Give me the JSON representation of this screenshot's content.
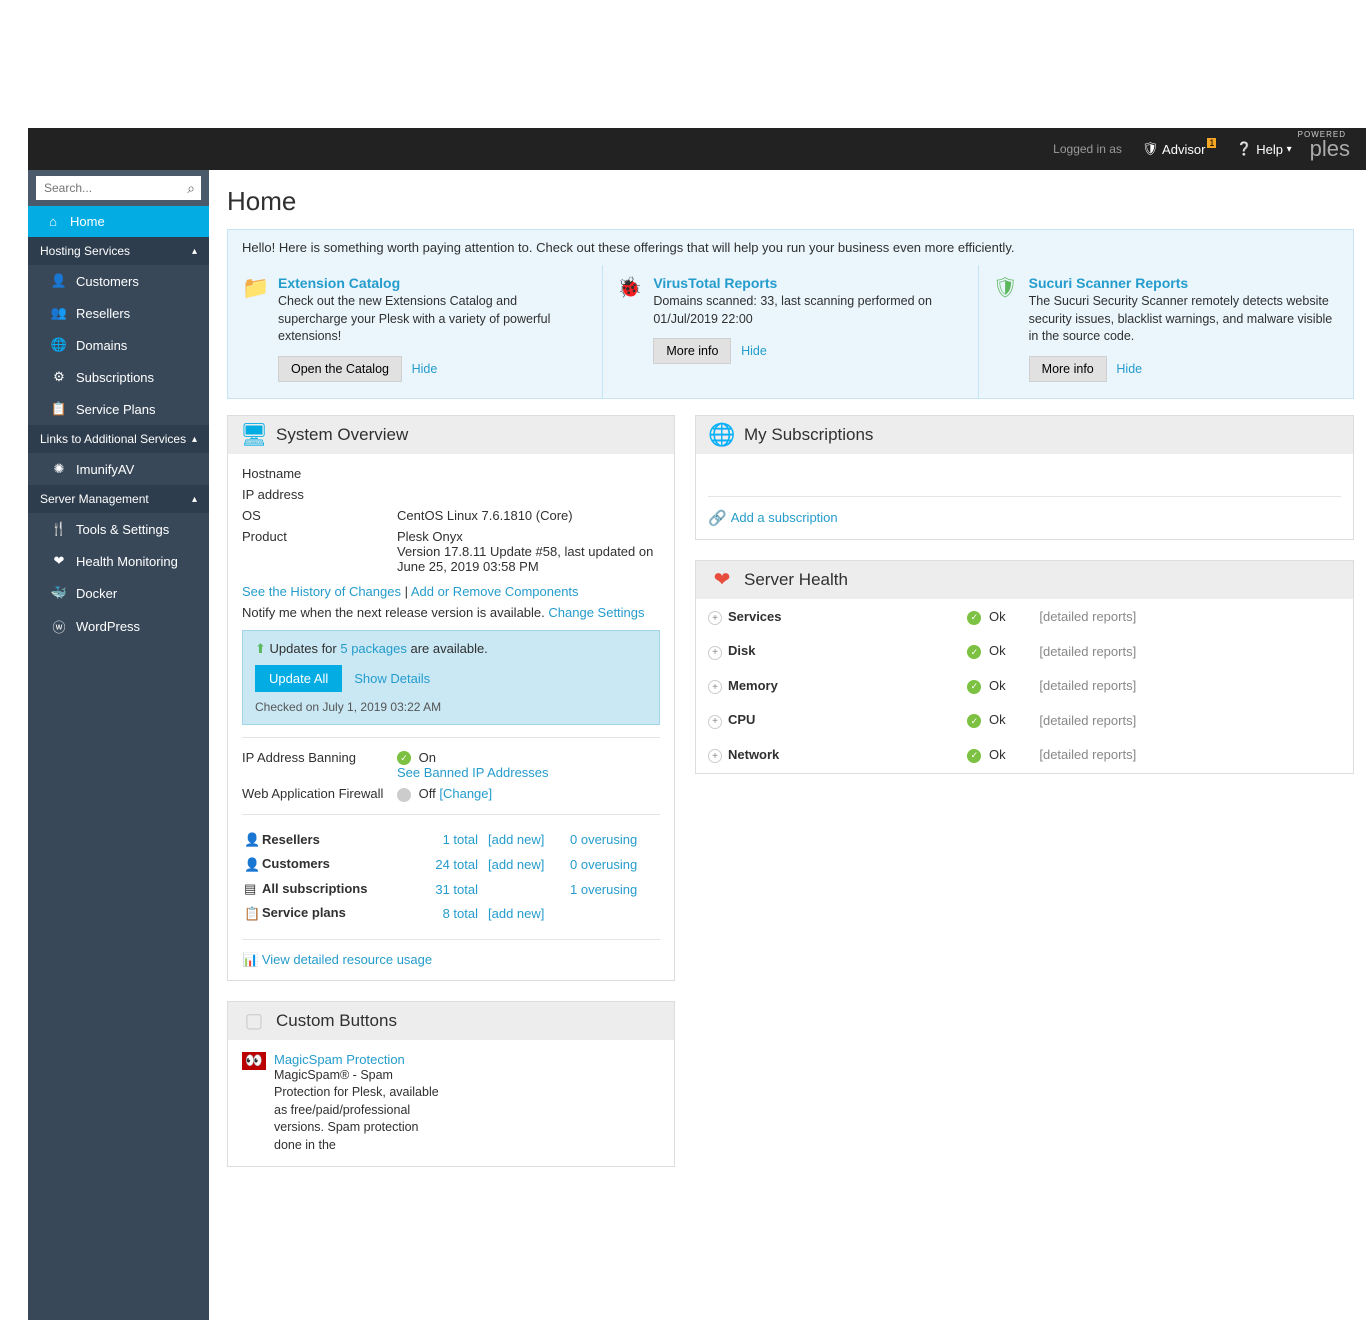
{
  "topbar": {
    "logged_in": "Logged in as",
    "advisor": "Advisor",
    "advisor_badge": "1",
    "help": "Help",
    "powered": "POWERED",
    "brand": "ples"
  },
  "sidebar": {
    "search_placeholder": "Search...",
    "home": "Home",
    "sections": {
      "hosting": "Hosting Services",
      "links": "Links to Additional Services",
      "server": "Server Management"
    },
    "items": {
      "customers": "Customers",
      "resellers": "Resellers",
      "domains": "Domains",
      "subscriptions": "Subscriptions",
      "service_plans": "Service Plans",
      "imunify": "ImunifyAV",
      "tools": "Tools & Settings",
      "health": "Health Monitoring",
      "docker": "Docker",
      "wordpress": "WordPress"
    }
  },
  "page": {
    "title": "Home",
    "notice": "Hello! Here is something worth paying attention to. Check out these offerings that will help you run your business even more efficiently."
  },
  "offerings": [
    {
      "title": "Extension Catalog",
      "desc": "Check out the new Extensions Catalog and supercharge your Plesk with a variety of powerful extensions!",
      "btn": "Open the Catalog",
      "hide": "Hide"
    },
    {
      "title": "VirusTotal Reports",
      "desc": "Domains scanned: 33, last scanning performed on 01/Jul/2019 22:00",
      "btn": "More info",
      "hide": "Hide"
    },
    {
      "title": "Sucuri Scanner Reports",
      "desc": "The Sucuri Security Scanner remotely detects website security issues, blacklist warnings, and malware visible in the source code.",
      "btn": "More info",
      "hide": "Hide"
    }
  ],
  "overview": {
    "title": "System Overview",
    "hostname_label": "Hostname",
    "ip_label": "IP address",
    "os_label": "OS",
    "os_value": "CentOS Linux 7.6.1810 (Core)",
    "product_label": "Product",
    "product_value": "Plesk Onyx",
    "product_version": "Version 17.8.11 Update #58, last updated on June 25, 2019 03:58 PM",
    "history_link": "See the History of Changes",
    "components_link": "Add or Remove Components",
    "notify_text": "Notify me when the next release version is available. ",
    "notify_link": "Change Settings",
    "updates_prefix": "Updates for ",
    "updates_link": "5 packages",
    "updates_suffix": " are available.",
    "update_btn": "Update All",
    "show_details": "Show Details",
    "checked": "Checked on July 1, 2019 03:22 AM",
    "ip_ban_label": "IP Address Banning",
    "ip_ban_status": "On",
    "ip_ban_link": "See Banned IP Addresses",
    "waf_label": "Web Application Firewall",
    "waf_status": "Off",
    "waf_change": "[Change]",
    "stats": {
      "resellers": {
        "label": "Resellers",
        "total": "1 total",
        "add": "[add new]",
        "over": "0 overusing"
      },
      "customers": {
        "label": "Customers",
        "total": "24 total",
        "add": "[add new]",
        "over": "0 overusing"
      },
      "subs": {
        "label": "All subscriptions",
        "total": "31 total",
        "over": "1 overusing"
      },
      "plans": {
        "label": "Service plans",
        "total": "8 total",
        "add": "[add new]"
      }
    },
    "detailed_link": "View detailed resource usage"
  },
  "my_subs": {
    "title": "My Subscriptions",
    "add": "Add a subscription"
  },
  "health": {
    "title": "Server Health",
    "rows": [
      {
        "label": "Services",
        "status": "Ok",
        "link": "[detailed reports]"
      },
      {
        "label": "Disk",
        "status": "Ok",
        "link": "[detailed reports]"
      },
      {
        "label": "Memory",
        "status": "Ok",
        "link": "[detailed reports]"
      },
      {
        "label": "CPU",
        "status": "Ok",
        "link": "[detailed reports]"
      },
      {
        "label": "Network",
        "status": "Ok",
        "link": "[detailed reports]"
      }
    ]
  },
  "custom_buttons": {
    "title": "Custom Buttons",
    "item_title": "MagicSpam Protection",
    "item_desc": "MagicSpam® - Spam Protection for Plesk, available as free/paid/professional versions. Spam protection done in the"
  }
}
